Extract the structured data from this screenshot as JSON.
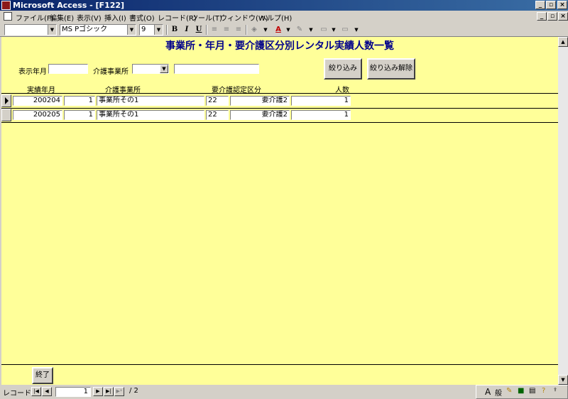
{
  "window": {
    "title": "Microsoft Access - [F122]"
  },
  "menubar": {
    "items": [
      "ファイル(F)",
      "編集(E)",
      "表示(V)",
      "挿入(I)",
      "書式(O)",
      "レコード(R)",
      "ツール(T)",
      "ウィンドウ(W)",
      "ヘルプ(H)"
    ]
  },
  "toolbar": {
    "font_name": "MS Pゴシック",
    "font_size": "9",
    "bold_label": "B",
    "italic_label": "I",
    "underline_label": "U"
  },
  "form": {
    "title": "事業所・年月・要介護区分別レンタル実績人数一覧",
    "filter": {
      "year_month_label": "表示年月",
      "year_month_value": "",
      "office_label": "介護事業所",
      "office_code_value": "",
      "office_name_value": "",
      "apply_button": "絞り込み",
      "clear_button": "絞り込み解除"
    },
    "columns": {
      "year_month": "実績年月",
      "office": "介護事業所",
      "care_level": "要介護認定区分",
      "count": "人数"
    },
    "rows": [
      {
        "year_month": "200204",
        "office_code": "1",
        "office_name": "事業所その1",
        "care_code": "22",
        "care_name": "要介護2",
        "count": "1"
      },
      {
        "year_month": "200205",
        "office_code": "1",
        "office_name": "事業所その1",
        "care_code": "22",
        "care_name": "要介護2",
        "count": "1"
      }
    ],
    "exit_button": "終了"
  },
  "navigation": {
    "label": "レコード:",
    "current": "1",
    "total": "/ 2"
  },
  "langbar": {
    "items": [
      "A",
      "般"
    ]
  }
}
